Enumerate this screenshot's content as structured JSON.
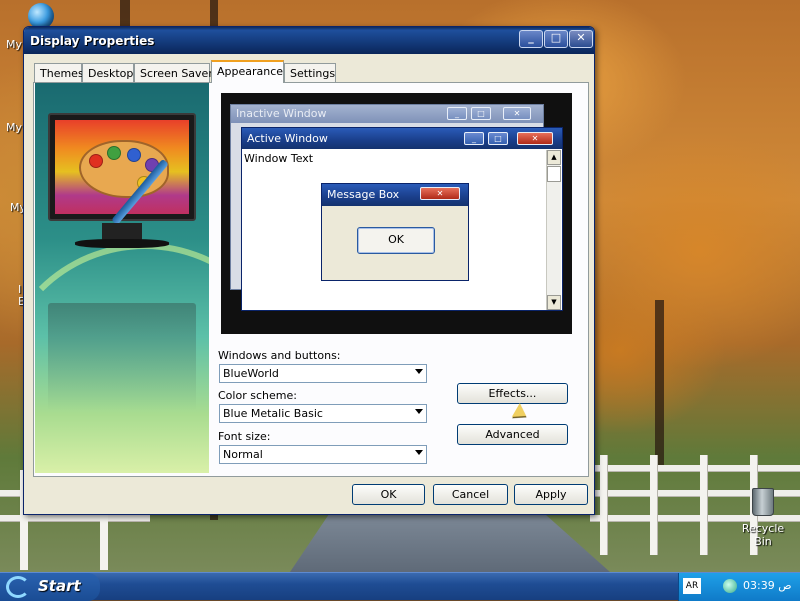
{
  "desktop": {
    "icons": [
      "My",
      "My",
      "My",
      "I",
      "E"
    ],
    "recycle_bin": "Recycle Bin"
  },
  "window": {
    "title": "Display Properties",
    "tabs": [
      {
        "label": "Themes"
      },
      {
        "label": "Desktop"
      },
      {
        "label": "Screen Saver"
      },
      {
        "label": "Appearance",
        "active": true
      },
      {
        "label": "Settings"
      }
    ]
  },
  "preview": {
    "inactive_title": "Inactive Window",
    "active_title": "Active Window",
    "window_text": "Window Text",
    "message_title": "Message Box",
    "ok_label": "OK"
  },
  "appearance": {
    "windows_buttons_label": "Windows and buttons:",
    "windows_buttons_value": "BlueWorld",
    "color_scheme_label": "Color scheme:",
    "color_scheme_value": "Blue Metalic Basic",
    "font_size_label": "Font size:",
    "font_size_value": "Normal",
    "effects_label": "Effects...",
    "advanced_label": "Advanced"
  },
  "footer": {
    "ok": "OK",
    "cancel": "Cancel",
    "apply": "Apply"
  },
  "taskbar": {
    "start_label": "Start",
    "language": "AR",
    "clock": "03:39 ص"
  },
  "colors": {
    "titlebar": "#1e4f9c",
    "dialog_bg": "#ece9d8",
    "active_tab_accent": "#f0a020"
  }
}
